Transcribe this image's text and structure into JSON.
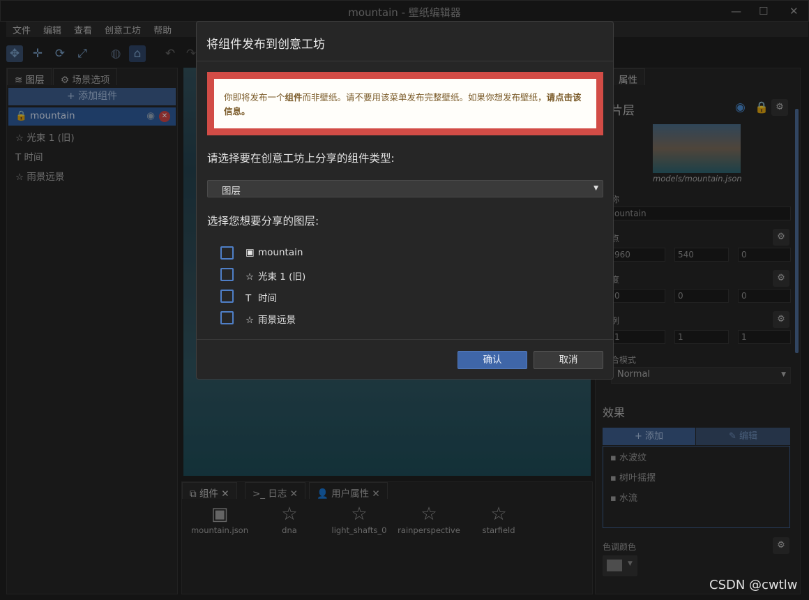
{
  "window": {
    "title": "mountain - 壁纸编辑器",
    "minimize": "—",
    "maximize": "☐",
    "close": "✕"
  },
  "menu": [
    "文件",
    "编辑",
    "查看",
    "创意工坊",
    "帮助"
  ],
  "left_panel": {
    "tabs": [
      "图层",
      "场景选项"
    ],
    "add_button": "+ 添加组件",
    "layers": [
      "mountain",
      "光束 1 (旧)",
      "时间",
      "雨景远景"
    ]
  },
  "bottom_panel": {
    "tabs": [
      "组件",
      "日志",
      "用户属性"
    ],
    "assets": [
      "mountain.json",
      "dna",
      "light_shafts_0",
      "rainperspective",
      "starfield"
    ]
  },
  "right_panel": {
    "tab": "属性",
    "section_title": "片层",
    "model_path": "models/mountain.json",
    "name_label": "称",
    "name_value": "ountain",
    "origin_label": "点",
    "origin": {
      "x": "960",
      "y": "540",
      "z": "0"
    },
    "angles_label": "度",
    "angles": {
      "x": "0",
      "y": "0",
      "z": "0"
    },
    "scale_label": "例",
    "scale": {
      "x": "1",
      "y": "1",
      "z": "1"
    },
    "blend_label": "合模式",
    "blend_value": "Normal",
    "effects_title": "效果",
    "effects_add": "添加",
    "effects_edit": "编辑",
    "effects": [
      "水波纹",
      "树叶摇摆",
      "水流"
    ],
    "tint_label": "色调颜色"
  },
  "modal": {
    "title": "将组件发布到创意工坊",
    "warning_pre": "你即将发布一个",
    "warning_bold1": "组件",
    "warning_mid": "而非壁纸。请不要用该菜单发布完整壁纸。如果你想发布壁纸，",
    "warning_bold2": "请点击该信息",
    "warning_end": "。",
    "q1": "请选择要在创意工坊上分享的组件类型:",
    "type_value": "图层",
    "q2": "选择您想要分享的图层:",
    "layers": [
      "mountain",
      "光束 1 (旧)",
      "时间",
      "雨景远景"
    ],
    "confirm": "确认",
    "cancel": "取消"
  },
  "watermark": "CSDN @cwtlw"
}
